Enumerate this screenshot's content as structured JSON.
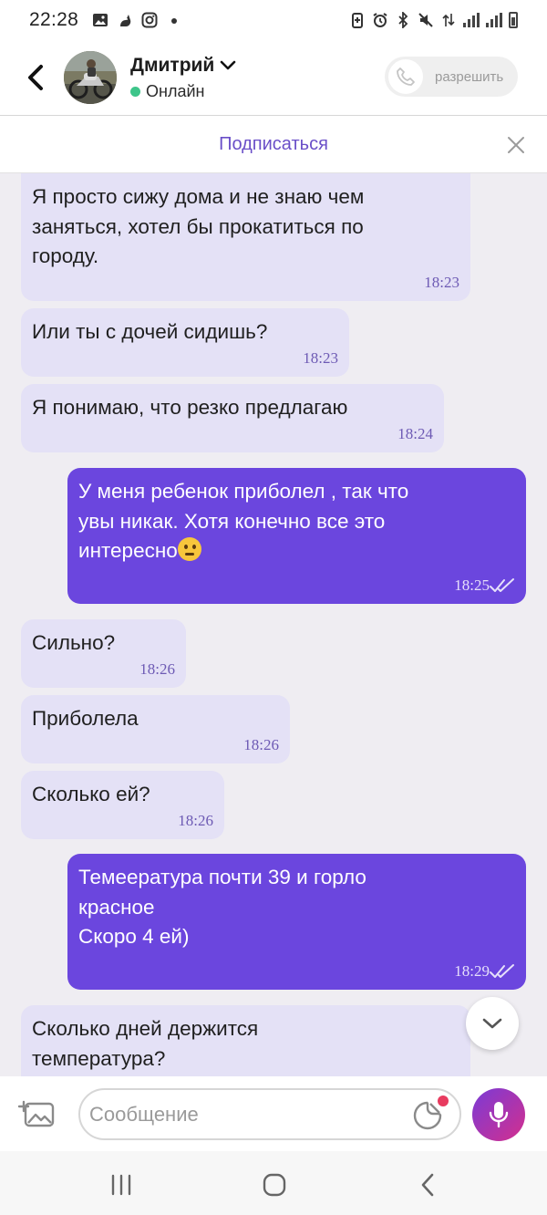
{
  "status_bar": {
    "time": "22:28"
  },
  "header": {
    "contact_name": "Дмитрий",
    "status": "Онлайн",
    "allow_label": "разрешить"
  },
  "banner": {
    "subscribe_label": "Подписаться"
  },
  "messages": [
    {
      "direction": "in",
      "text": "Я просто сижу дома и не знаю чем\nзаняться, хотел бы прокатиться по\nгороду.",
      "time": "18:23"
    },
    {
      "direction": "in",
      "text": "Или ты с дочей сидишь?",
      "time": "18:23"
    },
    {
      "direction": "in",
      "text": "Я понимаю, что резко предлагаю",
      "time": "18:24"
    },
    {
      "direction": "out",
      "text": "У меня ребенок приболел , так что\nувы никак. Хотя конечно все это\nинтересно",
      "time": "18:25",
      "emoji": "thinking-face",
      "read": true
    },
    {
      "direction": "in",
      "text": "Сильно?",
      "time": "18:26"
    },
    {
      "direction": "in",
      "text": "Приболела",
      "time": "18:26"
    },
    {
      "direction": "in",
      "text": "Сколько ей?",
      "time": "18:26"
    },
    {
      "direction": "out",
      "text": "Темеература почти 39 и горло\nкрасное\nСкоро 4 ей)",
      "time": "18:29",
      "read": true
    },
    {
      "direction": "in",
      "text": "Сколько дней держится\nтемпература?",
      "time": ""
    }
  ],
  "composer": {
    "placeholder": "Сообщение"
  },
  "colors": {
    "incoming_bubble": "#e4e1f6",
    "outgoing_bubble": "#6b46de",
    "accent": "#6a4fc8",
    "online": "#3ec58a"
  }
}
